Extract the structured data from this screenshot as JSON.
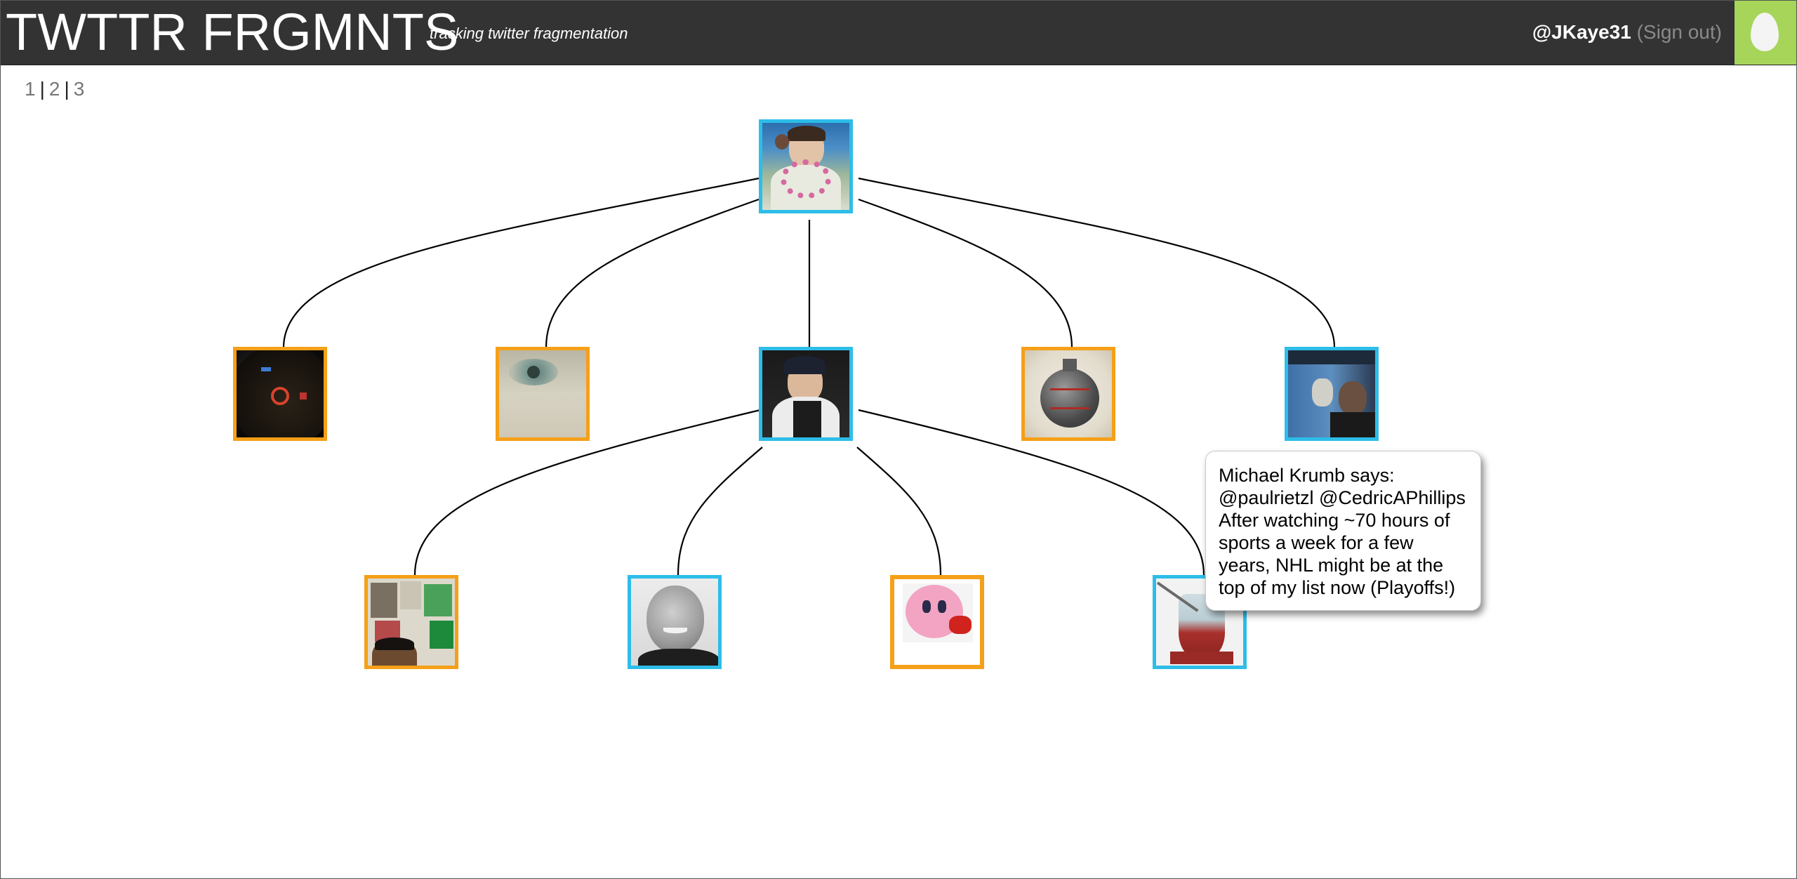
{
  "header": {
    "logo": "TWTTR FRGMNTS",
    "tagline": "tracking twitter fragmentation",
    "username": "@JKaye31",
    "signout": "(Sign out)",
    "accent_color": "#a6d55a",
    "bar_color": "#333333"
  },
  "pager": {
    "pages": [
      "1",
      "2",
      "3"
    ]
  },
  "node_colors": {
    "blue": "#2dbde8",
    "orange": "#f5a018"
  },
  "tooltip": {
    "speaker": "Michael Krumb says:",
    "text": "@paulrietzl @CedricAPhillips After watching ~70 hours of sports a week for a few years, NHL might be at the top of my list now (Playoffs!)"
  }
}
